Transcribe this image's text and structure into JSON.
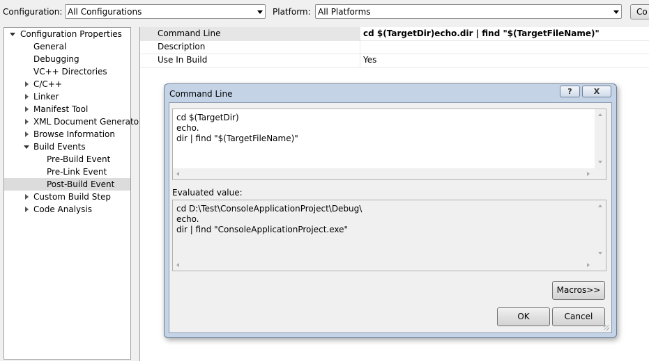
{
  "toolbar": {
    "configuration_label": "Configuration:",
    "configuration_value": "All Configurations",
    "platform_label": "Platform:",
    "platform_value": "All Platforms",
    "config_manager_label": "Co"
  },
  "tree": {
    "items": [
      {
        "label": "Configuration Properties"
      },
      {
        "label": "General"
      },
      {
        "label": "Debugging"
      },
      {
        "label": "VC++ Directories"
      },
      {
        "label": "C/C++"
      },
      {
        "label": "Linker"
      },
      {
        "label": "Manifest Tool"
      },
      {
        "label": "XML Document Generator"
      },
      {
        "label": "Browse Information"
      },
      {
        "label": "Build Events"
      },
      {
        "label": "Pre-Build Event"
      },
      {
        "label": "Pre-Link Event"
      },
      {
        "label": "Post-Build Event"
      },
      {
        "label": "Custom Build Step"
      },
      {
        "label": "Code Analysis"
      }
    ]
  },
  "properties": [
    {
      "name": "Command Line",
      "value": "cd $(TargetDir)echo.dir | find \"$(TargetFileName)\""
    },
    {
      "name": "Description",
      "value": ""
    },
    {
      "name": "Use In Build",
      "value": "Yes"
    }
  ],
  "dialog": {
    "title": "Command Line",
    "help_label": "?",
    "close_label": "X",
    "command_text": "cd $(TargetDir)\necho.\ndir | find \"$(TargetFileName)\"",
    "evaluated_label": "Evaluated value:",
    "evaluated_text": "cd D:\\Test\\ConsoleApplicationProject\\Debug\\\necho.\ndir | find \"ConsoleApplicationProject.exe\"",
    "macros_label": "Macros>>",
    "ok_label": "OK",
    "cancel_label": "Cancel"
  }
}
